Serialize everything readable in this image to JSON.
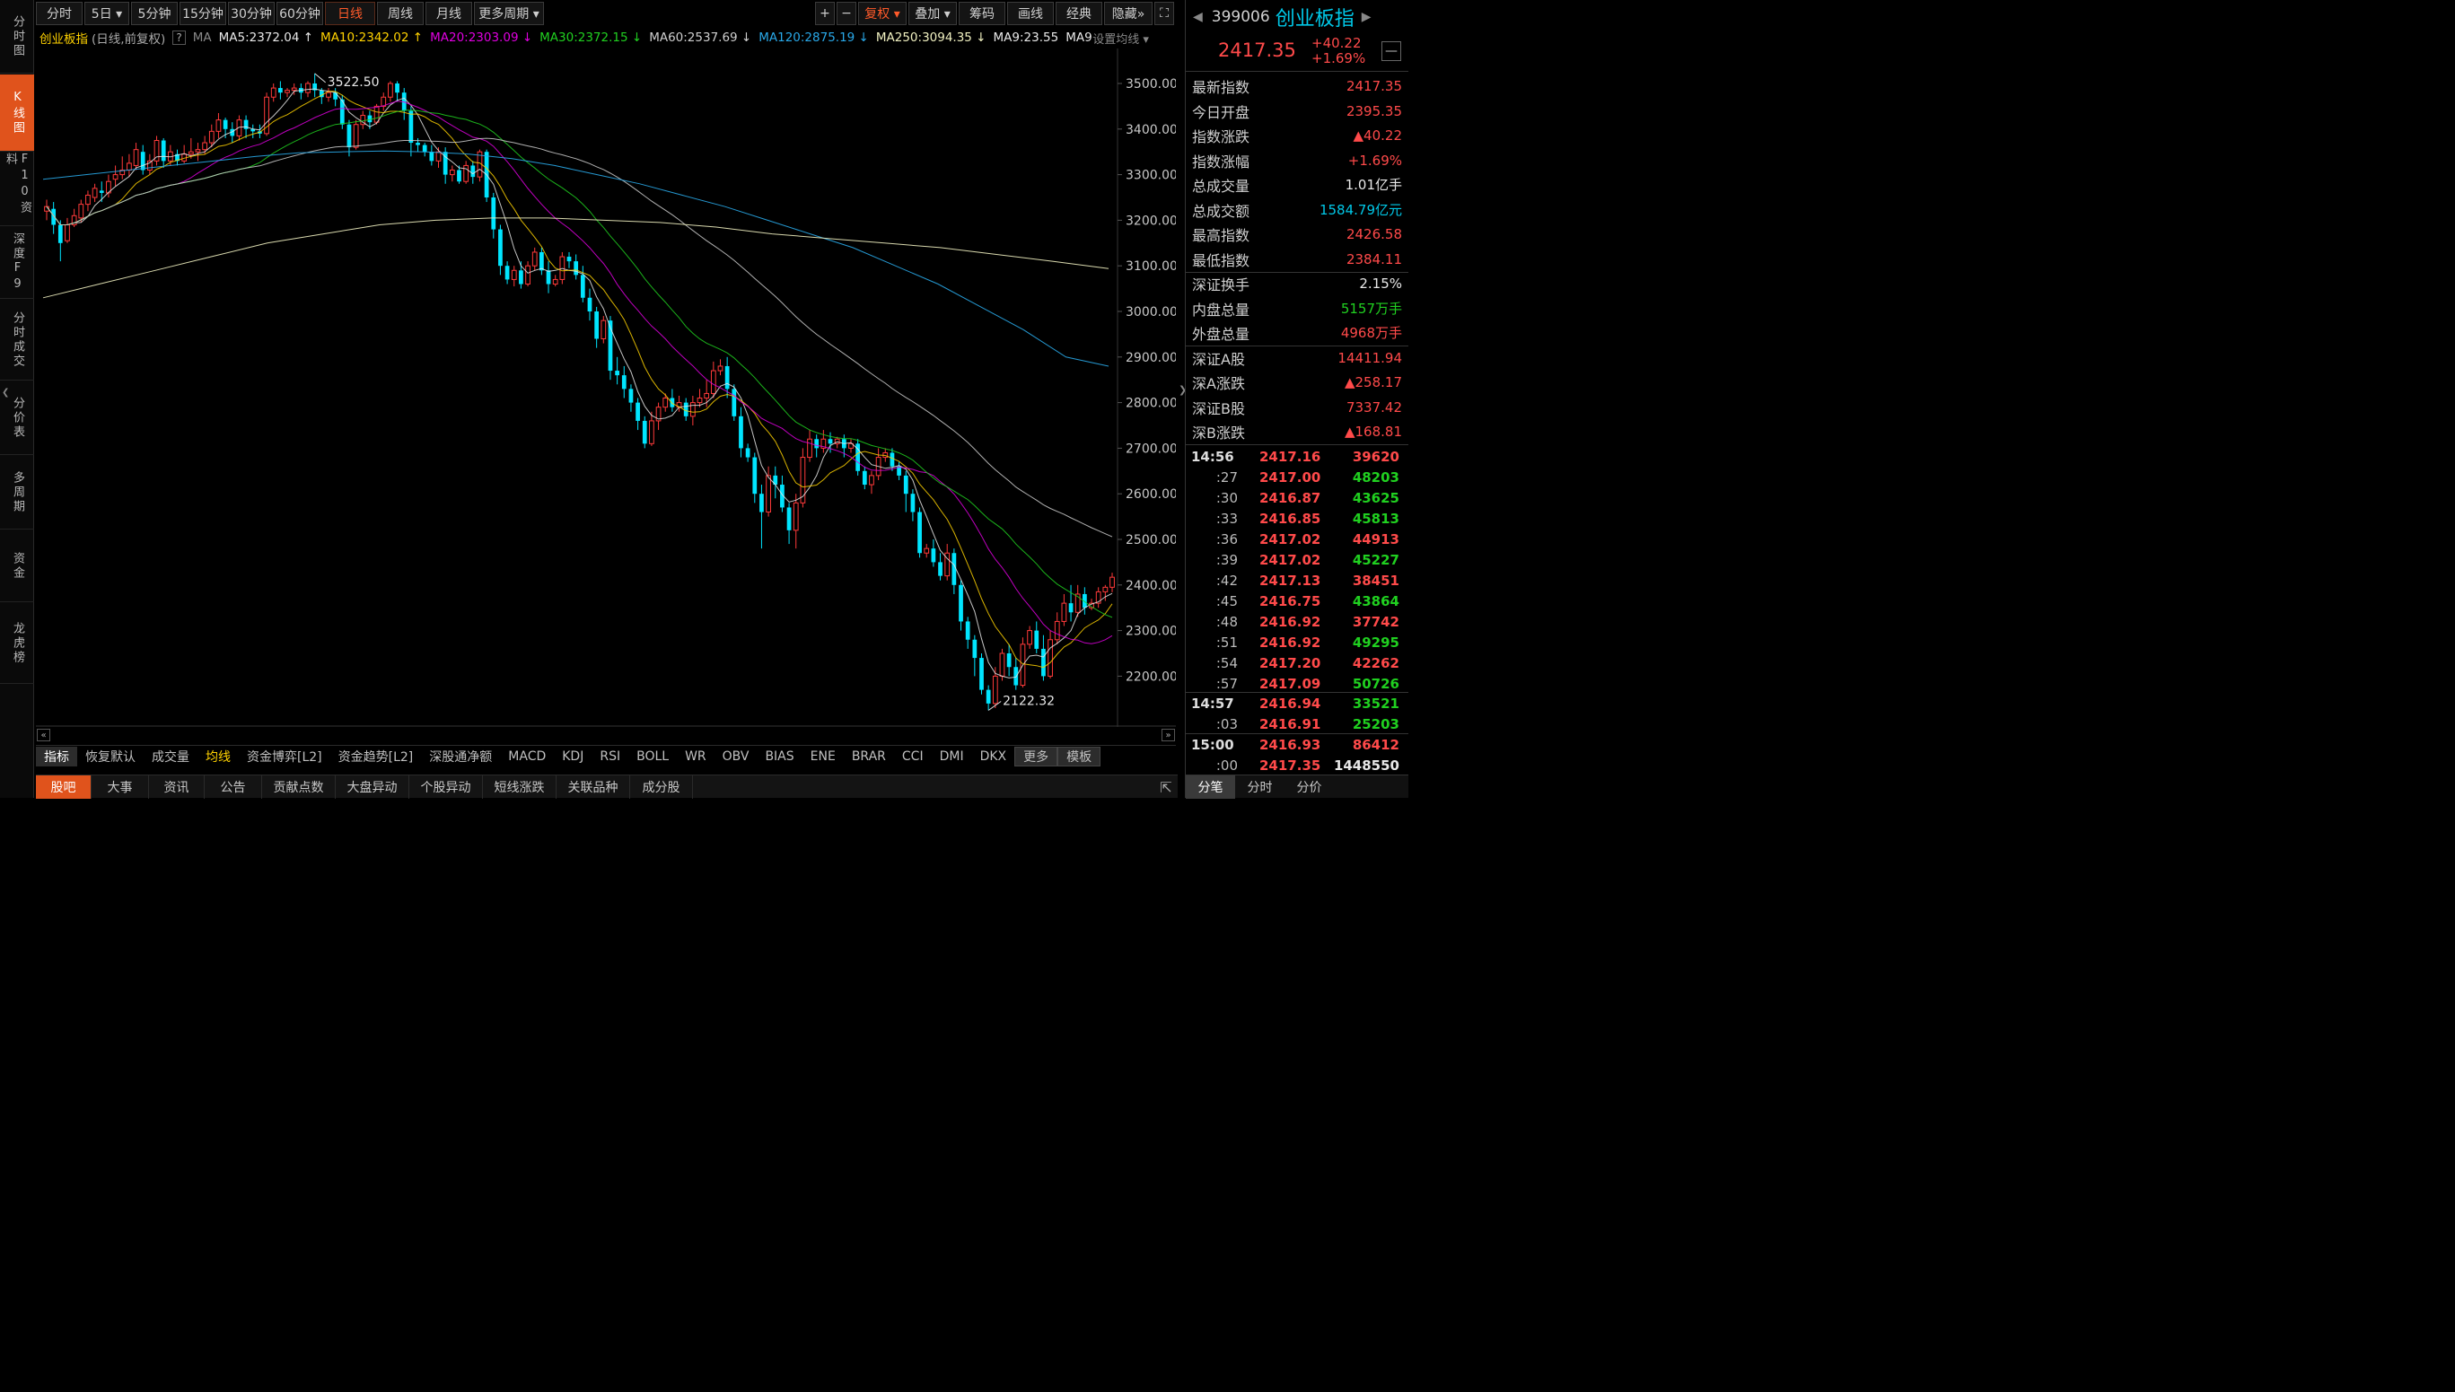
{
  "left_rail": [
    {
      "id": "fenshi",
      "label": "分时图",
      "active": false
    },
    {
      "id": "kline",
      "label": "K线图",
      "active": true
    },
    {
      "id": "f10",
      "label": "F10资料",
      "active": false
    },
    {
      "id": "depth",
      "label": "深度F9",
      "active": false
    },
    {
      "id": "tick",
      "label": "分时成交",
      "active": false
    },
    {
      "id": "price-table",
      "label": "分价表",
      "active": false
    },
    {
      "id": "multi-period",
      "label": "多周期",
      "active": false
    },
    {
      "id": "capital",
      "label": "资金",
      "active": false
    },
    {
      "id": "dragon-tiger",
      "label": "龙虎榜",
      "active": false
    }
  ],
  "period_bar": [
    {
      "label": "分时"
    },
    {
      "label": "5日 ▾"
    },
    {
      "label": "5分钟"
    },
    {
      "label": "15分钟"
    },
    {
      "label": "30分钟"
    },
    {
      "label": "60分钟"
    },
    {
      "label": "日线",
      "active": true
    },
    {
      "label": "周线"
    },
    {
      "label": "月线"
    },
    {
      "label": "更多周期 ▾"
    }
  ],
  "tool_bar": [
    {
      "label": "+"
    },
    {
      "label": "−"
    },
    {
      "label": "复权 ▾",
      "highlight": true
    },
    {
      "label": "叠加 ▾"
    },
    {
      "label": "筹码"
    },
    {
      "label": "画线"
    },
    {
      "label": "经典"
    },
    {
      "label": "隐藏»"
    },
    {
      "label": "⛶"
    }
  ],
  "ma_legend": {
    "name": "创业板指",
    "mode": "(日线,前复权)",
    "help": "?",
    "ma_label": "MA",
    "items": [
      {
        "text": "MA5:2372.04 ↑",
        "color": "#e8e8e8"
      },
      {
        "text": "MA10:2342.02 ↑",
        "color": "#ffd200"
      },
      {
        "text": "MA20:2303.09 ↓",
        "color": "#e000e0"
      },
      {
        "text": "MA30:2372.15 ↓",
        "color": "#20d020"
      },
      {
        "text": "MA60:2537.69 ↓",
        "color": "#cfcfcf"
      },
      {
        "text": "MA120:2875.19 ↓",
        "color": "#29a8e8"
      },
      {
        "text": "MA250:3094.35 ↓",
        "color": "#f0f0c0"
      },
      {
        "text": "MA9:23.55",
        "color": "#e8e8e8"
      },
      {
        "text": "MA9:",
        "color": "#e8e8e8"
      }
    ],
    "settings": "设置均线 ▾"
  },
  "chart_data": {
    "type": "candlestick",
    "y_ticks": [
      "3500.00",
      "3400.00",
      "3300.00",
      "3200.00",
      "3100.00",
      "3000.00",
      "2900.00",
      "2800.00",
      "2700.00",
      "2600.00",
      "2500.00",
      "2400.00",
      "2300.00",
      "2200.00"
    ],
    "ylim": [
      2100,
      3560
    ],
    "high_label": "3522.50",
    "low_label": "2122.32",
    "candles": [
      [
        3220,
        3230,
        3200,
        3245
      ],
      [
        3225,
        3190,
        3170,
        3240
      ],
      [
        3190,
        3150,
        3110,
        3200
      ],
      [
        3155,
        3190,
        3150,
        3205
      ],
      [
        3190,
        3210,
        3185,
        3225
      ],
      [
        3205,
        3235,
        3195,
        3245
      ],
      [
        3235,
        3255,
        3220,
        3265
      ],
      [
        3250,
        3270,
        3240,
        3280
      ],
      [
        3265,
        3260,
        3240,
        3285
      ],
      [
        3260,
        3285,
        3250,
        3300
      ],
      [
        3290,
        3300,
        3275,
        3320
      ],
      [
        3300,
        3310,
        3290,
        3340
      ],
      [
        3310,
        3325,
        3295,
        3345
      ],
      [
        3320,
        3355,
        3310,
        3370
      ],
      [
        3350,
        3310,
        3300,
        3365
      ],
      [
        3310,
        3330,
        3300,
        3345
      ],
      [
        3330,
        3375,
        3320,
        3385
      ],
      [
        3375,
        3330,
        3315,
        3380
      ],
      [
        3330,
        3350,
        3320,
        3365
      ],
      [
        3345,
        3330,
        3320,
        3355
      ],
      [
        3330,
        3345,
        3325,
        3365
      ],
      [
        3345,
        3350,
        3335,
        3380
      ],
      [
        3350,
        3355,
        3330,
        3370
      ],
      [
        3355,
        3370,
        3345,
        3385
      ],
      [
        3370,
        3395,
        3360,
        3410
      ],
      [
        3395,
        3420,
        3380,
        3435
      ],
      [
        3420,
        3400,
        3380,
        3425
      ],
      [
        3400,
        3385,
        3370,
        3415
      ],
      [
        3385,
        3420,
        3375,
        3430
      ],
      [
        3420,
        3400,
        3380,
        3430
      ],
      [
        3400,
        3395,
        3380,
        3410
      ],
      [
        3395,
        3390,
        3380,
        3410
      ],
      [
        3390,
        3470,
        3385,
        3480
      ],
      [
        3470,
        3490,
        3460,
        3500
      ],
      [
        3490,
        3480,
        3465,
        3505
      ],
      [
        3480,
        3485,
        3470,
        3490
      ],
      [
        3485,
        3490,
        3475,
        3500
      ],
      [
        3490,
        3480,
        3465,
        3500
      ],
      [
        3480,
        3500,
        3470,
        3505
      ],
      [
        3500,
        3485,
        3470,
        3522
      ],
      [
        3485,
        3470,
        3455,
        3490
      ],
      [
        3470,
        3480,
        3460,
        3490
      ],
      [
        3480,
        3465,
        3450,
        3490
      ],
      [
        3465,
        3410,
        3400,
        3475
      ],
      [
        3410,
        3360,
        3340,
        3420
      ],
      [
        3360,
        3410,
        3355,
        3420
      ],
      [
        3410,
        3430,
        3400,
        3440
      ],
      [
        3430,
        3415,
        3400,
        3440
      ],
      [
        3415,
        3450,
        3410,
        3455
      ],
      [
        3450,
        3470,
        3440,
        3480
      ],
      [
        3470,
        3500,
        3460,
        3505
      ],
      [
        3500,
        3480,
        3460,
        3505
      ],
      [
        3480,
        3440,
        3420,
        3490
      ],
      [
        3440,
        3370,
        3340,
        3450
      ],
      [
        3370,
        3365,
        3350,
        3380
      ],
      [
        3365,
        3350,
        3340,
        3370
      ],
      [
        3350,
        3330,
        3320,
        3365
      ],
      [
        3330,
        3350,
        3315,
        3360
      ],
      [
        3350,
        3300,
        3280,
        3360
      ],
      [
        3300,
        3310,
        3285,
        3320
      ],
      [
        3310,
        3285,
        3280,
        3320
      ],
      [
        3285,
        3320,
        3280,
        3330
      ],
      [
        3320,
        3295,
        3280,
        3330
      ],
      [
        3295,
        3350,
        3285,
        3355
      ],
      [
        3350,
        3250,
        3240,
        3355
      ],
      [
        3250,
        3180,
        3160,
        3260
      ],
      [
        3180,
        3100,
        3080,
        3190
      ],
      [
        3100,
        3070,
        3060,
        3110
      ],
      [
        3070,
        3090,
        3055,
        3100
      ],
      [
        3090,
        3060,
        3050,
        3110
      ],
      [
        3060,
        3100,
        3055,
        3110
      ],
      [
        3100,
        3130,
        3090,
        3140
      ],
      [
        3130,
        3090,
        3080,
        3140
      ],
      [
        3090,
        3060,
        3040,
        3110
      ],
      [
        3060,
        3070,
        3055,
        3080
      ],
      [
        3070,
        3120,
        3060,
        3130
      ],
      [
        3120,
        3110,
        3095,
        3130
      ],
      [
        3110,
        3080,
        3070,
        3125
      ],
      [
        3080,
        3030,
        3020,
        3100
      ],
      [
        3030,
        3000,
        2980,
        3050
      ],
      [
        3000,
        2940,
        2920,
        3010
      ],
      [
        2940,
        2980,
        2930,
        2990
      ],
      [
        2980,
        2870,
        2850,
        2990
      ],
      [
        2870,
        2860,
        2840,
        2900
      ],
      [
        2860,
        2830,
        2810,
        2880
      ],
      [
        2830,
        2800,
        2780,
        2840
      ],
      [
        2800,
        2760,
        2740,
        2810
      ],
      [
        2760,
        2710,
        2700,
        2770
      ],
      [
        2710,
        2760,
        2705,
        2780
      ],
      [
        2760,
        2790,
        2740,
        2800
      ],
      [
        2790,
        2810,
        2780,
        2820
      ],
      [
        2810,
        2790,
        2780,
        2830
      ],
      [
        2790,
        2800,
        2780,
        2815
      ],
      [
        2800,
        2770,
        2760,
        2810
      ],
      [
        2770,
        2800,
        2750,
        2815
      ],
      [
        2800,
        2810,
        2790,
        2830
      ],
      [
        2810,
        2820,
        2790,
        2850
      ],
      [
        2820,
        2870,
        2810,
        2890
      ],
      [
        2870,
        2880,
        2860,
        2895
      ],
      [
        2880,
        2830,
        2810,
        2900
      ],
      [
        2830,
        2770,
        2760,
        2840
      ],
      [
        2770,
        2700,
        2680,
        2790
      ],
      [
        2700,
        2680,
        2670,
        2710
      ],
      [
        2680,
        2600,
        2580,
        2690
      ],
      [
        2600,
        2560,
        2480,
        2620
      ],
      [
        2560,
        2640,
        2550,
        2660
      ],
      [
        2640,
        2620,
        2590,
        2660
      ],
      [
        2620,
        2570,
        2560,
        2640
      ],
      [
        2570,
        2520,
        2490,
        2580
      ],
      [
        2520,
        2580,
        2480,
        2600
      ],
      [
        2580,
        2680,
        2570,
        2700
      ],
      [
        2680,
        2720,
        2670,
        2740
      ],
      [
        2720,
        2700,
        2680,
        2730
      ],
      [
        2700,
        2720,
        2690,
        2740
      ],
      [
        2720,
        2710,
        2690,
        2735
      ],
      [
        2710,
        2720,
        2700,
        2725
      ],
      [
        2720,
        2700,
        2680,
        2730
      ],
      [
        2700,
        2710,
        2690,
        2720
      ],
      [
        2710,
        2650,
        2640,
        2720
      ],
      [
        2650,
        2620,
        2610,
        2660
      ],
      [
        2620,
        2640,
        2600,
        2650
      ],
      [
        2640,
        2680,
        2630,
        2700
      ],
      [
        2680,
        2690,
        2670,
        2700
      ],
      [
        2690,
        2660,
        2650,
        2700
      ],
      [
        2660,
        2640,
        2630,
        2670
      ],
      [
        2640,
        2600,
        2560,
        2650
      ],
      [
        2600,
        2560,
        2540,
        2610
      ],
      [
        2560,
        2470,
        2460,
        2570
      ],
      [
        2470,
        2480,
        2460,
        2490
      ],
      [
        2480,
        2450,
        2440,
        2500
      ],
      [
        2450,
        2420,
        2410,
        2470
      ],
      [
        2420,
        2470,
        2410,
        2490
      ],
      [
        2470,
        2400,
        2380,
        2480
      ],
      [
        2400,
        2320,
        2300,
        2410
      ],
      [
        2320,
        2280,
        2260,
        2330
      ],
      [
        2280,
        2240,
        2200,
        2290
      ],
      [
        2240,
        2170,
        2160,
        2250
      ],
      [
        2170,
        2140,
        2125,
        2180
      ],
      [
        2140,
        2200,
        2130,
        2220
      ],
      [
        2200,
        2250,
        2190,
        2260
      ],
      [
        2250,
        2220,
        2200,
        2270
      ],
      [
        2220,
        2180,
        2170,
        2240
      ],
      [
        2180,
        2270,
        2175,
        2285
      ],
      [
        2270,
        2300,
        2260,
        2310
      ],
      [
        2300,
        2260,
        2250,
        2320
      ],
      [
        2260,
        2200,
        2190,
        2290
      ],
      [
        2200,
        2280,
        2195,
        2300
      ],
      [
        2280,
        2320,
        2270,
        2340
      ],
      [
        2320,
        2360,
        2310,
        2380
      ],
      [
        2360,
        2340,
        2320,
        2400
      ],
      [
        2340,
        2380,
        2330,
        2400
      ],
      [
        2380,
        2350,
        2335,
        2395
      ],
      [
        2350,
        2360,
        2345,
        2370
      ],
      [
        2360,
        2385,
        2350,
        2395
      ],
      [
        2385,
        2395,
        2365,
        2400
      ],
      [
        2395,
        2417,
        2384,
        2427
      ]
    ]
  },
  "indicator_tabs": [
    {
      "label": "指标",
      "style": "active"
    },
    {
      "label": "恢复默认"
    },
    {
      "label": "成交量"
    },
    {
      "label": "均线",
      "style": "yellow"
    },
    {
      "label": "资金博弈[L2]"
    },
    {
      "label": "资金趋势[L2]"
    },
    {
      "label": "深股通净额"
    },
    {
      "label": "MACD"
    },
    {
      "label": "KDJ"
    },
    {
      "label": "RSI"
    },
    {
      "label": "BOLL"
    },
    {
      "label": "WR"
    },
    {
      "label": "OBV"
    },
    {
      "label": "BIAS"
    },
    {
      "label": "ENE"
    },
    {
      "label": "BRAR"
    },
    {
      "label": "CCI"
    },
    {
      "label": "DMI"
    },
    {
      "label": "DKX"
    },
    {
      "label": "更多",
      "style": "box"
    },
    {
      "label": "模板",
      "style": "box"
    }
  ],
  "bottom_tabs": [
    {
      "label": "股吧",
      "active": true
    },
    {
      "label": "大事"
    },
    {
      "label": "资讯"
    },
    {
      "label": "公告"
    },
    {
      "label": "贡献点数"
    },
    {
      "label": "大盘异动"
    },
    {
      "label": "个股异动"
    },
    {
      "label": "短线涨跌"
    },
    {
      "label": "关联品种"
    },
    {
      "label": "成分股"
    }
  ],
  "quote": {
    "code": "399006",
    "name": "创业板指",
    "price": "2417.35",
    "change": "+40.22",
    "change_pct": "+1.69%",
    "rows": [
      {
        "k": "最新指数",
        "v": "2417.35",
        "c": "#ff4a4a"
      },
      {
        "k": "今日开盘",
        "v": "2395.35",
        "c": "#ff4a4a"
      },
      {
        "k": "指数涨跌",
        "v": "▲40.22",
        "c": "#ff4a4a"
      },
      {
        "k": "指数涨幅",
        "v": "+1.69%",
        "c": "#ff4a4a"
      },
      {
        "k": "总成交量",
        "v": "1.01亿手",
        "c": "#e8e8e8"
      },
      {
        "k": "总成交额",
        "v": "1584.79亿元",
        "c": "#00c8e8"
      },
      {
        "k": "最高指数",
        "v": "2426.58",
        "c": "#ff4a4a"
      },
      {
        "k": "最低指数",
        "v": "2384.11",
        "c": "#ff4a4a"
      },
      {
        "k": "深证换手",
        "v": "2.15%",
        "c": "#e8e8e8"
      },
      {
        "k": "内盘总量",
        "v": "5157万手",
        "c": "#20d020"
      },
      {
        "k": "外盘总量",
        "v": "4968万手",
        "c": "#ff4a4a"
      },
      {
        "k": "深证A股",
        "v": "14411.94",
        "c": "#ff4a4a"
      },
      {
        "k": "深A涨跌",
        "v": "▲258.17",
        "c": "#ff4a4a"
      },
      {
        "k": "深证B股",
        "v": "7337.42",
        "c": "#ff4a4a"
      },
      {
        "k": "深B涨跌",
        "v": "▲168.81",
        "c": "#ff4a4a"
      }
    ],
    "ticks": [
      {
        "t": "14:56",
        "p": "2417.16",
        "v": "39620",
        "vc": "#ff4a4a",
        "main": true
      },
      {
        "t": ":27",
        "p": "2417.00",
        "v": "48203",
        "vc": "#20d020"
      },
      {
        "t": ":30",
        "p": "2416.87",
        "v": "43625",
        "vc": "#20d020"
      },
      {
        "t": ":33",
        "p": "2416.85",
        "v": "45813",
        "vc": "#20d020"
      },
      {
        "t": ":36",
        "p": "2417.02",
        "v": "44913",
        "vc": "#ff4a4a"
      },
      {
        "t": ":39",
        "p": "2417.02",
        "v": "45227",
        "vc": "#20d020"
      },
      {
        "t": ":42",
        "p": "2417.13",
        "v": "38451",
        "vc": "#ff4a4a"
      },
      {
        "t": ":45",
        "p": "2416.75",
        "v": "43864",
        "vc": "#20d020"
      },
      {
        "t": ":48",
        "p": "2416.92",
        "v": "37742",
        "vc": "#ff4a4a"
      },
      {
        "t": ":51",
        "p": "2416.92",
        "v": "49295",
        "vc": "#20d020"
      },
      {
        "t": ":54",
        "p": "2417.20",
        "v": "42262",
        "vc": "#ff4a4a"
      },
      {
        "t": ":57",
        "p": "2417.09",
        "v": "50726",
        "vc": "#20d020"
      },
      {
        "t": "14:57",
        "p": "2416.94",
        "v": "33521",
        "vc": "#20d020",
        "main": true
      },
      {
        "t": ":03",
        "p": "2416.91",
        "v": "25203",
        "vc": "#20d020"
      },
      {
        "t": "15:00",
        "p": "2416.93",
        "v": "86412",
        "vc": "#ff4a4a",
        "main": true
      },
      {
        "t": ":00",
        "p": "2417.35",
        "v": "1448550",
        "vc": "#e8e8e8"
      }
    ],
    "tabs": [
      {
        "label": "分笔",
        "active": true
      },
      {
        "label": "分时"
      },
      {
        "label": "分价"
      }
    ]
  }
}
